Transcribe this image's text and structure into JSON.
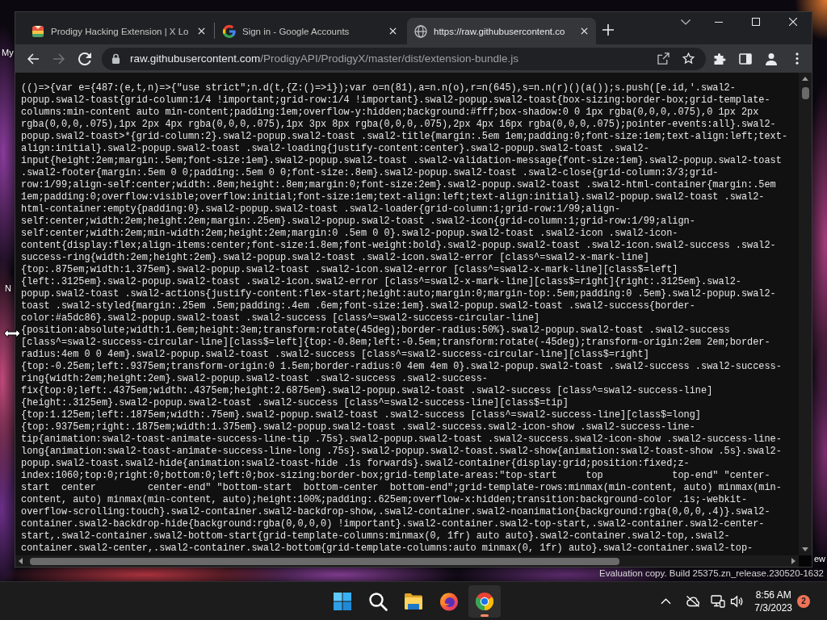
{
  "desktop_labels": [
    "My",
    "N",
    "ew"
  ],
  "browser": {
    "tabs": [
      {
        "title": "Prodigy Hacking Extension | X Lo",
        "selected": false
      },
      {
        "title": "Sign in - Google Accounts",
        "selected": false
      },
      {
        "title": "https://raw.githubusercontent.co",
        "selected": true
      }
    ],
    "nav_buttons": [
      {
        "kind": "back",
        "disabled": false
      },
      {
        "kind": "forward",
        "disabled": true
      },
      {
        "kind": "reload",
        "disabled": false
      }
    ],
    "address": {
      "host": "raw.githubusercontent.com",
      "path": "/ProdigyAPI/ProdigyX/master/dist/extension-bundle.js"
    }
  },
  "code_lines": [
    "(()=>{var e={487:(e,t,n)=>{\"use strict\";n.d(t,{Z:()=>i});var o=n(81),a=n.n(o),r=n(645),s=n.n(r)()(a());s.push([e.id,'.swal2-",
    "popup.swal2-toast{grid-column:1/4 !important;grid-row:1/4 !important}.swal2-popup.swal2-toast{box-sizing:border-box;grid-template-",
    "columns:min-content auto min-content;padding:1em;overflow-y:hidden;background:#fff;box-shadow:0 0 1px rgba(0,0,0,.075),0 1px 2px",
    "rgba(0,0,0,.075),1px 2px 4px rgba(0,0,0,.075),1px 3px 8px rgba(0,0,0,.075),2px 4px 16px rgba(0,0,0,.075);pointer-events:all}.swal2-",
    "popup.swal2-toast>*{grid-column:2}.swal2-popup.swal2-toast .swal2-title{margin:.5em 1em;padding:0;font-size:1em;text-align:left;text-",
    "align:initial}.swal2-popup.swal2-toast .swal2-loading{justify-content:center}.swal2-popup.swal2-toast .swal2-",
    "input{height:2em;margin:.5em;font-size:1em}.swal2-popup.swal2-toast .swal2-validation-message{font-size:1em}.swal2-popup.swal2-toast",
    ".swal2-footer{margin:.5em 0 0;padding:.5em 0 0;font-size:.8em}.swal2-popup.swal2-toast .swal2-close{grid-column:3/3;grid-",
    "row:1/99;align-self:center;width:.8em;height:.8em;margin:0;font-size:2em}.swal2-popup.swal2-toast .swal2-html-container{margin:.5em",
    "1em;padding:0;overflow:visible;overflow:initial;font-size:1em;text-align:left;text-align:initial}.swal2-popup.swal2-toast .swal2-",
    "html-container:empty{padding:0}.swal2-popup.swal2-toast .swal2-loader{grid-column:1;grid-row:1/99;align-",
    "self:center;width:2em;height:2em;margin:.25em}.swal2-popup.swal2-toast .swal2-icon{grid-column:1;grid-row:1/99;align-",
    "self:center;width:2em;min-width:2em;height:2em;margin:0 .5em 0 0}.swal2-popup.swal2-toast .swal2-icon .swal2-icon-",
    "content{display:flex;align-items:center;font-size:1.8em;font-weight:bold}.swal2-popup.swal2-toast .swal2-icon.swal2-success .swal2-",
    "success-ring{width:2em;height:2em}.swal2-popup.swal2-toast .swal2-icon.swal2-error [class^=swal2-x-mark-line]",
    "{top:.875em;width:1.375em}.swal2-popup.swal2-toast .swal2-icon.swal2-error [class^=swal2-x-mark-line][class$=left]",
    "{left:.3125em}.swal2-popup.swal2-toast .swal2-icon.swal2-error [class^=swal2-x-mark-line][class$=right]{right:.3125em}.swal2-",
    "popup.swal2-toast .swal2-actions{justify-content:flex-start;height:auto;margin:0;margin-top:.5em;padding:0 .5em}.swal2-popup.swal2-",
    "toast .swal2-styled{margin:.25em .5em;padding:.4em .6em;font-size:1em}.swal2-popup.swal2-toast .swal2-success{border-",
    "color:#a5dc86}.swal2-popup.swal2-toast .swal2-success [class^=swal2-success-circular-line]",
    "{position:absolute;width:1.6em;height:3em;transform:rotate(45deg);border-radius:50%}.swal2-popup.swal2-toast .swal2-success",
    "[class^=swal2-success-circular-line][class$=left]{top:-0.8em;left:-0.5em;transform:rotate(-45deg);transform-origin:2em 2em;border-",
    "radius:4em 0 0 4em}.swal2-popup.swal2-toast .swal2-success [class^=swal2-success-circular-line][class$=right]",
    "{top:-0.25em;left:.9375em;transform-origin:0 1.5em;border-radius:0 4em 4em 0}.swal2-popup.swal2-toast .swal2-success .swal2-success-",
    "ring{width:2em;height:2em}.swal2-popup.swal2-toast .swal2-success .swal2-success-",
    "fix{top:0;left:.4375em;width:.4375em;height:2.6875em}.swal2-popup.swal2-toast .swal2-success [class^=swal2-success-line]",
    "{height:.3125em}.swal2-popup.swal2-toast .swal2-success [class^=swal2-success-line][class$=tip]",
    "{top:1.125em;left:.1875em;width:.75em}.swal2-popup.swal2-toast .swal2-success [class^=swal2-success-line][class$=long]",
    "{top:.9375em;right:.1875em;width:1.375em}.swal2-popup.swal2-toast .swal2-success.swal2-icon-show .swal2-success-line-",
    "tip{animation:swal2-toast-animate-success-line-tip .75s}.swal2-popup.swal2-toast .swal2-success.swal2-icon-show .swal2-success-line-",
    "long{animation:swal2-toast-animate-success-line-long .75s}.swal2-popup.swal2-toast.swal2-show{animation:swal2-toast-show .5s}.swal2-",
    "popup.swal2-toast.swal2-hide{animation:swal2-toast-hide .1s forwards}.swal2-container{display:grid;position:fixed;z-",
    "index:1060;top:0;right:0;bottom:0;left:0;box-sizing:border-box;grid-template-areas:\"top-start     top            top-end\" \"center-",
    "start  center         center-end\" \"bottom-start  bottom-center  bottom-end\";grid-template-rows:minmax(min-content, auto) minmax(min-",
    "content, auto) minmax(min-content, auto);height:100%;padding:.625em;overflow-x:hidden;transition:background-color .1s;-webkit-",
    "overflow-scrolling:touch}.swal2-container.swal2-backdrop-show,.swal2-container.swal2-noanimation{background:rgba(0,0,0,.4)}.swal2-",
    "container.swal2-backdrop-hide{background:rgba(0,0,0,0) !important}.swal2-container.swal2-top-start,.swal2-container.swal2-center-",
    "start,.swal2-container.swal2-bottom-start{grid-template-columns:minmax(0, 1fr) auto auto}.swal2-container.swal2-top,.swal2-",
    "container.swal2-center,.swal2-container.swal2-bottom{grid-template-columns:auto minmax(0, 1fr) auto}.swal2-container.swal2-top-"
  ],
  "watermark": "Evaluation copy. Build 25375.zn_release.230520-1632",
  "taskbar": {
    "apps": [
      {
        "kind": "start",
        "selected": false
      },
      {
        "kind": "search",
        "selected": false
      },
      {
        "kind": "folder",
        "selected": false
      },
      {
        "kind": "firefox",
        "selected": false
      },
      {
        "kind": "chrome",
        "selected": true
      }
    ],
    "time": "8:56 AM",
    "date": "7/3/2023",
    "notification_count": "2"
  }
}
